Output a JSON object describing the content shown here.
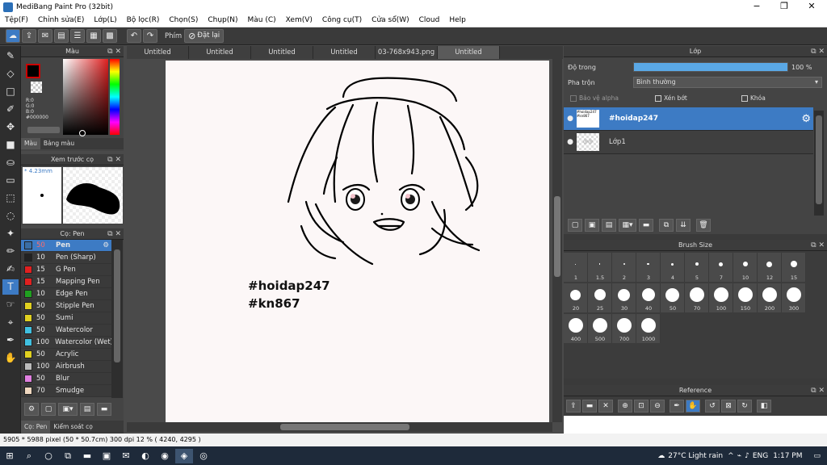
{
  "window": {
    "title": "MediBang Paint Pro (32bit)",
    "min": "−",
    "max": "❐",
    "close": "✕"
  },
  "menu": [
    "Tệp(F)",
    "Chỉnh sửa(E)",
    "Lớp(L)",
    "Bộ lọc(R)",
    "Chọn(S)",
    "Chụp(N)",
    "Màu (C)",
    "Xem(V)",
    "Công cụ(T)",
    "Cửa sổ(W)",
    "Cloud",
    "Help"
  ],
  "toolbar": {
    "phim_label": "Phím",
    "reset_label": "Đặt lại"
  },
  "color_panel": {
    "title": "Màu",
    "r": "R:0",
    "g": "G:0",
    "b": "B:0",
    "hex": "#000000",
    "tab_color": "Màu",
    "tab_palette": "Bảng màu"
  },
  "brush_preview": {
    "title": "Xem trước cọ",
    "size": "* 4.23mm"
  },
  "brush_panel": {
    "title": "Cọ: Pen",
    "items": [
      {
        "size": "50",
        "name": "Pen",
        "color": "#3a6ea5"
      },
      {
        "size": "10",
        "name": "Pen (Sharp)",
        "color": "#222222"
      },
      {
        "size": "15",
        "name": "G Pen",
        "color": "#e02020"
      },
      {
        "size": "15",
        "name": "Mapping Pen",
        "color": "#e02020"
      },
      {
        "size": "10",
        "name": "Edge Pen",
        "color": "#20a020"
      },
      {
        "size": "50",
        "name": "Stipple Pen",
        "color": "#e0d020"
      },
      {
        "size": "50",
        "name": "Sumi",
        "color": "#e0d020"
      },
      {
        "size": "50",
        "name": "Watercolor",
        "color": "#40c0e0"
      },
      {
        "size": "100",
        "name": "Watercolor (Wet)",
        "color": "#40c0e0"
      },
      {
        "size": "50",
        "name": "Acrylic",
        "color": "#e0d020"
      },
      {
        "size": "100",
        "name": "Airbrush",
        "color": "#bbbbbb"
      },
      {
        "size": "50",
        "name": "Blur",
        "color": "#e080e0"
      },
      {
        "size": "70",
        "name": "Smudge",
        "color": "#f0d8c0"
      }
    ],
    "tab1": "Cọ: Pen",
    "tab2": "Kiểm soát cọ"
  },
  "tabs": [
    "Untitled",
    "Untitled",
    "Untitled",
    "Untitled",
    "03-768x943.png",
    "Untitled"
  ],
  "canvas": {
    "text1": "#hoidap247",
    "text2": "#kn867"
  },
  "layer_panel": {
    "title": "Lớp",
    "opacity_label": "Độ trong",
    "opacity_value": "100 %",
    "opacity_level": 1.0,
    "blend_label": "Pha trộn",
    "blend_value": "Bình thường",
    "alpha_label": "Bảo vệ alpha",
    "clip_label": "Xén bớt",
    "lock_label": "Khóa",
    "layers": [
      {
        "name": "#hoidap247",
        "thumb": "#hoidap247\n#kn867"
      },
      {
        "name": "Lớp1",
        "thumb": "@@"
      }
    ]
  },
  "brush_size": {
    "title": "Brush Size",
    "sizes": [
      "1",
      "1.5",
      "2",
      "3",
      "4",
      "5",
      "7",
      "10",
      "12",
      "15",
      "20",
      "25",
      "30",
      "40",
      "50",
      "70",
      "100",
      "150",
      "200",
      "300",
      "400",
      "500",
      "700",
      "1000"
    ]
  },
  "reference": {
    "title": "Reference"
  },
  "status": "5905 * 5988 pixel  (50 * 50.7cm)  300 dpi  12 %  ( 4240, 4295 )",
  "taskbar": {
    "weather": "27°C  Light rain",
    "lang": "ENG",
    "time": "1:17 PM"
  }
}
